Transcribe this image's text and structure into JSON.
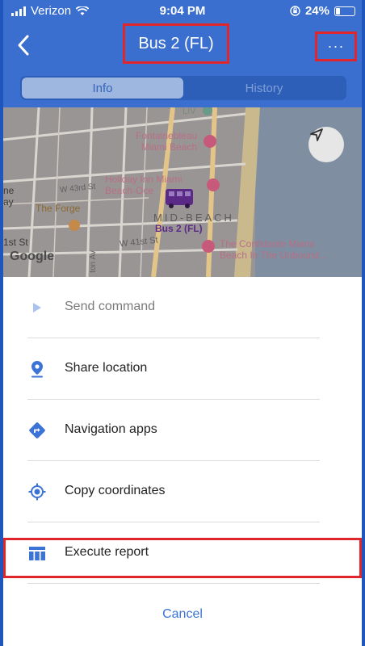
{
  "status_bar": {
    "carrier": "Verizon",
    "time": "9:04 PM",
    "battery": "24%",
    "battery_level": 0.24
  },
  "header": {
    "back": "‹",
    "title": "Bus 2 (FL)",
    "more": "···"
  },
  "tabs": [
    {
      "label": "Info",
      "selected": true
    },
    {
      "label": "History",
      "selected": false
    }
  ],
  "map": {
    "labels": {
      "liv": "LIV",
      "fontainebleau": "Fontainebleau\nMiami Beach",
      "holiday_inn": "Holiday Inn Miami\nBeach-Oce",
      "w43": "W 43rd St",
      "forge": "The Forge",
      "mid_beach": "MID-BEACH",
      "bus": "Bus 2 (FL)",
      "w41": "W 41st St",
      "confidante": "The Confidante Miami\nBeach In The Unbound...",
      "first_st": "1st St",
      "ne": "ne",
      "ay": "ay",
      "google": "Google",
      "vertical_road": "ton Av"
    }
  },
  "actions": [
    {
      "label": "Send command",
      "icon": "play-icon",
      "enabled": false
    },
    {
      "label": "Share location",
      "icon": "location-pin-icon",
      "enabled": true
    },
    {
      "label": "Navigation apps",
      "icon": "directions-icon",
      "enabled": true
    },
    {
      "label": "Copy coordinates",
      "icon": "crosshair-icon",
      "enabled": true
    },
    {
      "label": "Execute report",
      "icon": "table-icon",
      "enabled": true
    }
  ],
  "cancel_label": "Cancel",
  "colors": {
    "header": "#3a6fd0",
    "accent": "#3b73d6",
    "highlight": "#e0262b",
    "bus_marker": "#5b2a86"
  }
}
